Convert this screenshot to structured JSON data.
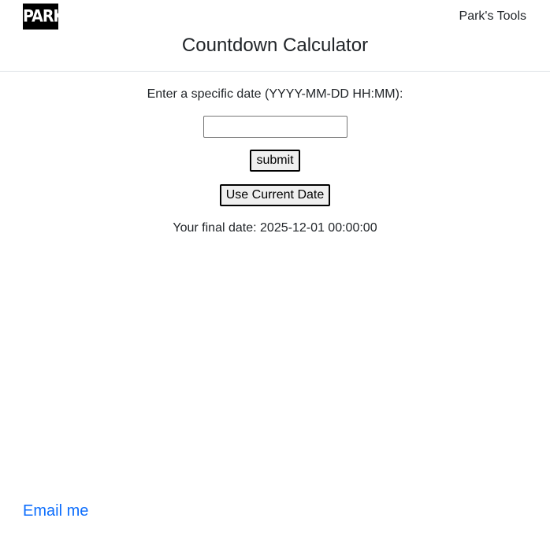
{
  "header": {
    "logo_text": "PARK",
    "tools_link": "Park's Tools",
    "title": "Countdown Calculator"
  },
  "form": {
    "prompt": "Enter a specific date (YYYY-MM-DD HH:MM):",
    "date_value": "",
    "submit_label": "submit",
    "current_date_label": "Use Current Date"
  },
  "result": {
    "prefix": "Your final date:",
    "value": "2025-12-01 00:00:00"
  },
  "footer": {
    "email_link": "Email me"
  },
  "colors": {
    "link": "#0d6efd",
    "text": "#212529",
    "divider": "#dee2e6"
  }
}
